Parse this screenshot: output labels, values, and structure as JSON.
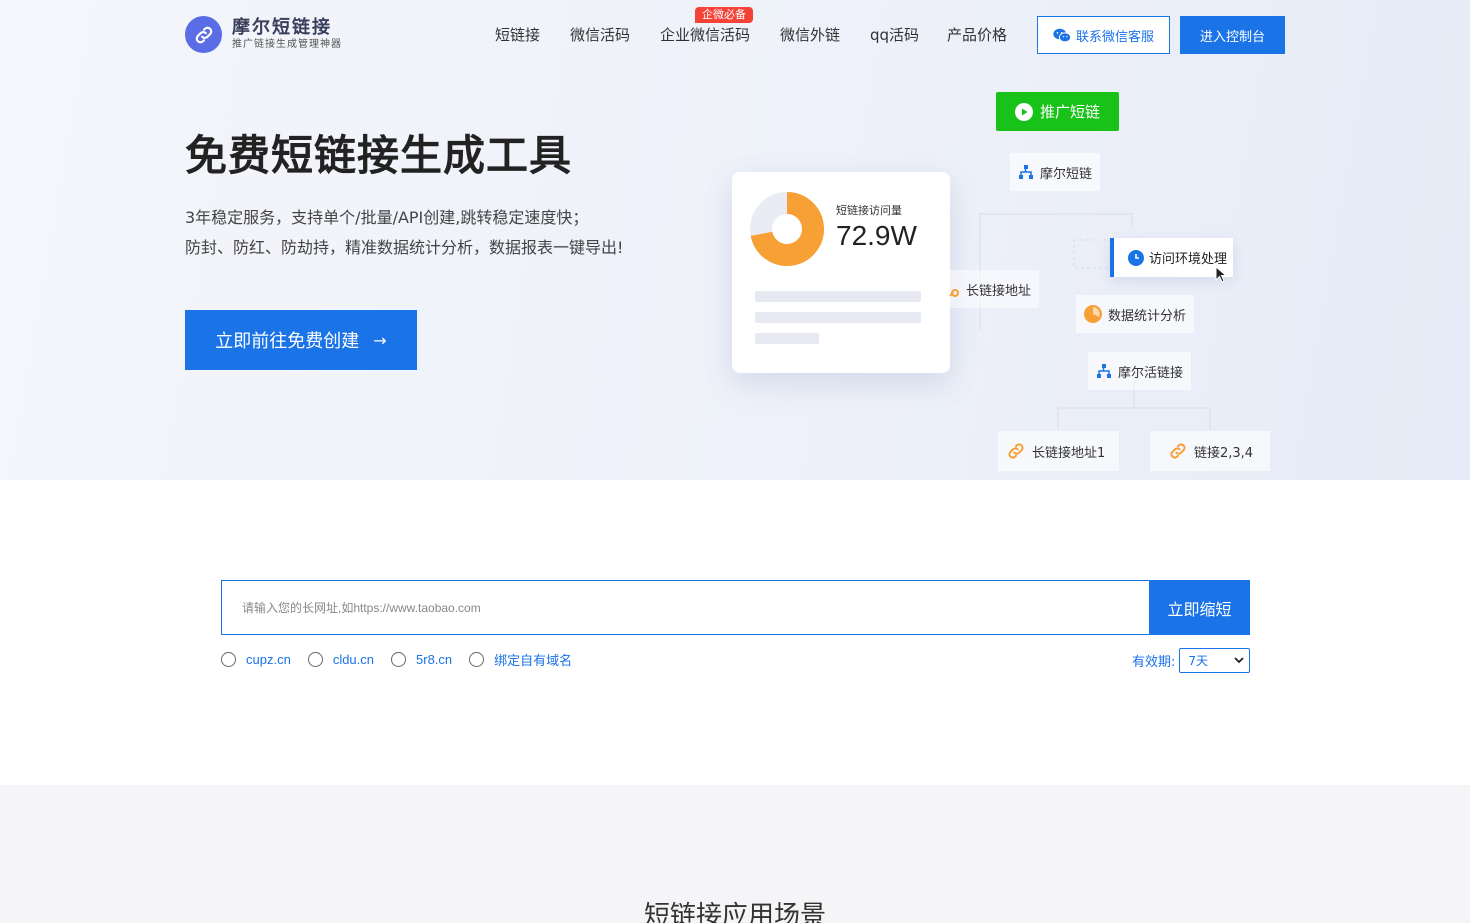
{
  "header": {
    "logo_title": "摩尔短链接",
    "logo_subtitle": "推广链接生成管理神器",
    "nav": [
      "短链接",
      "微信活码",
      "企业微信活码",
      "微信外链",
      "qq活码",
      "产品价格"
    ],
    "nav_badge": "企微必备",
    "wechat_button": "联系微信客服",
    "console_button": "进入控制台"
  },
  "hero": {
    "title": "免费短链接生成工具",
    "desc_line1": "3年稳定服务，支持单个/批量/API创建,跳转稳定速度快；",
    "desc_line2": "防封、防红、防劫持，精准数据统计分析，数据报表一键导出!",
    "cta_label": "立即前往免费创建",
    "cta_arrow": "→"
  },
  "illustration": {
    "card_label": "短链接访问量",
    "card_value": "72.9W",
    "donut_fraction": 0.72,
    "tag_promote": "推广短链",
    "tag_moer_short": "摩尔短链",
    "tag_env": "访问环境处理",
    "tag_long": "长链接地址",
    "tag_stats": "数据统计分析",
    "tag_moer_live": "摩尔活链接",
    "tag_long1": "长链接地址1",
    "tag_links": "链接2,3,4"
  },
  "shorten": {
    "placeholder": "请输入您的长网址,如https://www.taobao.com",
    "button": "立即缩短",
    "domains": [
      "cupz.cn",
      "cldu.cn",
      "5r8.cn",
      "绑定自有域名"
    ],
    "validity_label": "有效期:",
    "validity_value": "7天"
  },
  "scenes": {
    "title": "短链接应用场景"
  },
  "colors": {
    "primary": "#1b73e8",
    "green": "#18c218",
    "orange": "#f7a035",
    "badge": "#f44336"
  }
}
